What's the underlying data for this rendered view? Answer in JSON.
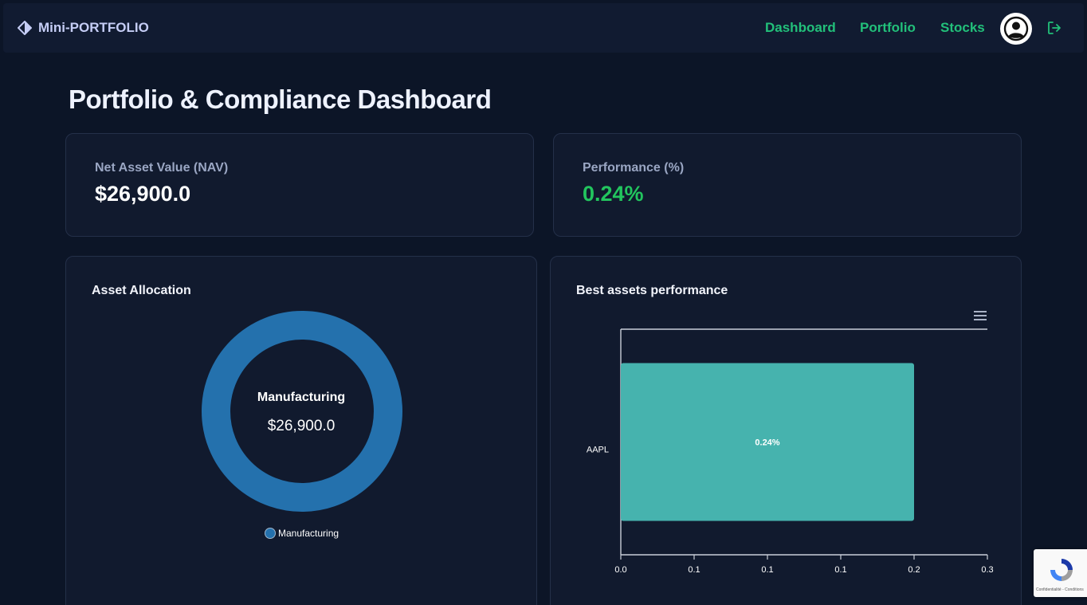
{
  "app": {
    "brand": "Mini-PORTFOLIO",
    "nav": [
      "Dashboard",
      "Portfolio",
      "Stocks"
    ]
  },
  "page": {
    "title": "Portfolio & Compliance Dashboard"
  },
  "kpis": {
    "nav_label": "Net Asset Value (NAV)",
    "nav_value": "$26,900.0",
    "perf_label": "Performance (%)",
    "perf_value": "0.24%"
  },
  "allocation": {
    "title": "Asset Allocation",
    "center_label": "Manufacturing",
    "center_value": "$26,900.0",
    "legend": "Manufacturing"
  },
  "performance_chart": {
    "title": "Best assets performance"
  },
  "recaptcha": {
    "text": "Confidentialité - Conditions"
  },
  "colors": {
    "accent": "#22c07a",
    "donut": "#2471ad",
    "bar": "#46b3ae",
    "positive": "#22c55e"
  },
  "chart_data": [
    {
      "type": "pie",
      "title": "Asset Allocation",
      "categories": [
        "Manufacturing"
      ],
      "values": [
        26900.0
      ],
      "legend": "bottom"
    },
    {
      "type": "bar",
      "orientation": "horizontal",
      "title": "Best assets performance",
      "categories": [
        "AAPL"
      ],
      "values": [
        0.24
      ],
      "data_labels": [
        "0.24%"
      ],
      "x_ticks": [
        "0.0",
        "0.1",
        "0.1",
        "0.1",
        "0.2",
        "0.3"
      ],
      "xlim": [
        0,
        0.3
      ],
      "grid": false
    }
  ]
}
